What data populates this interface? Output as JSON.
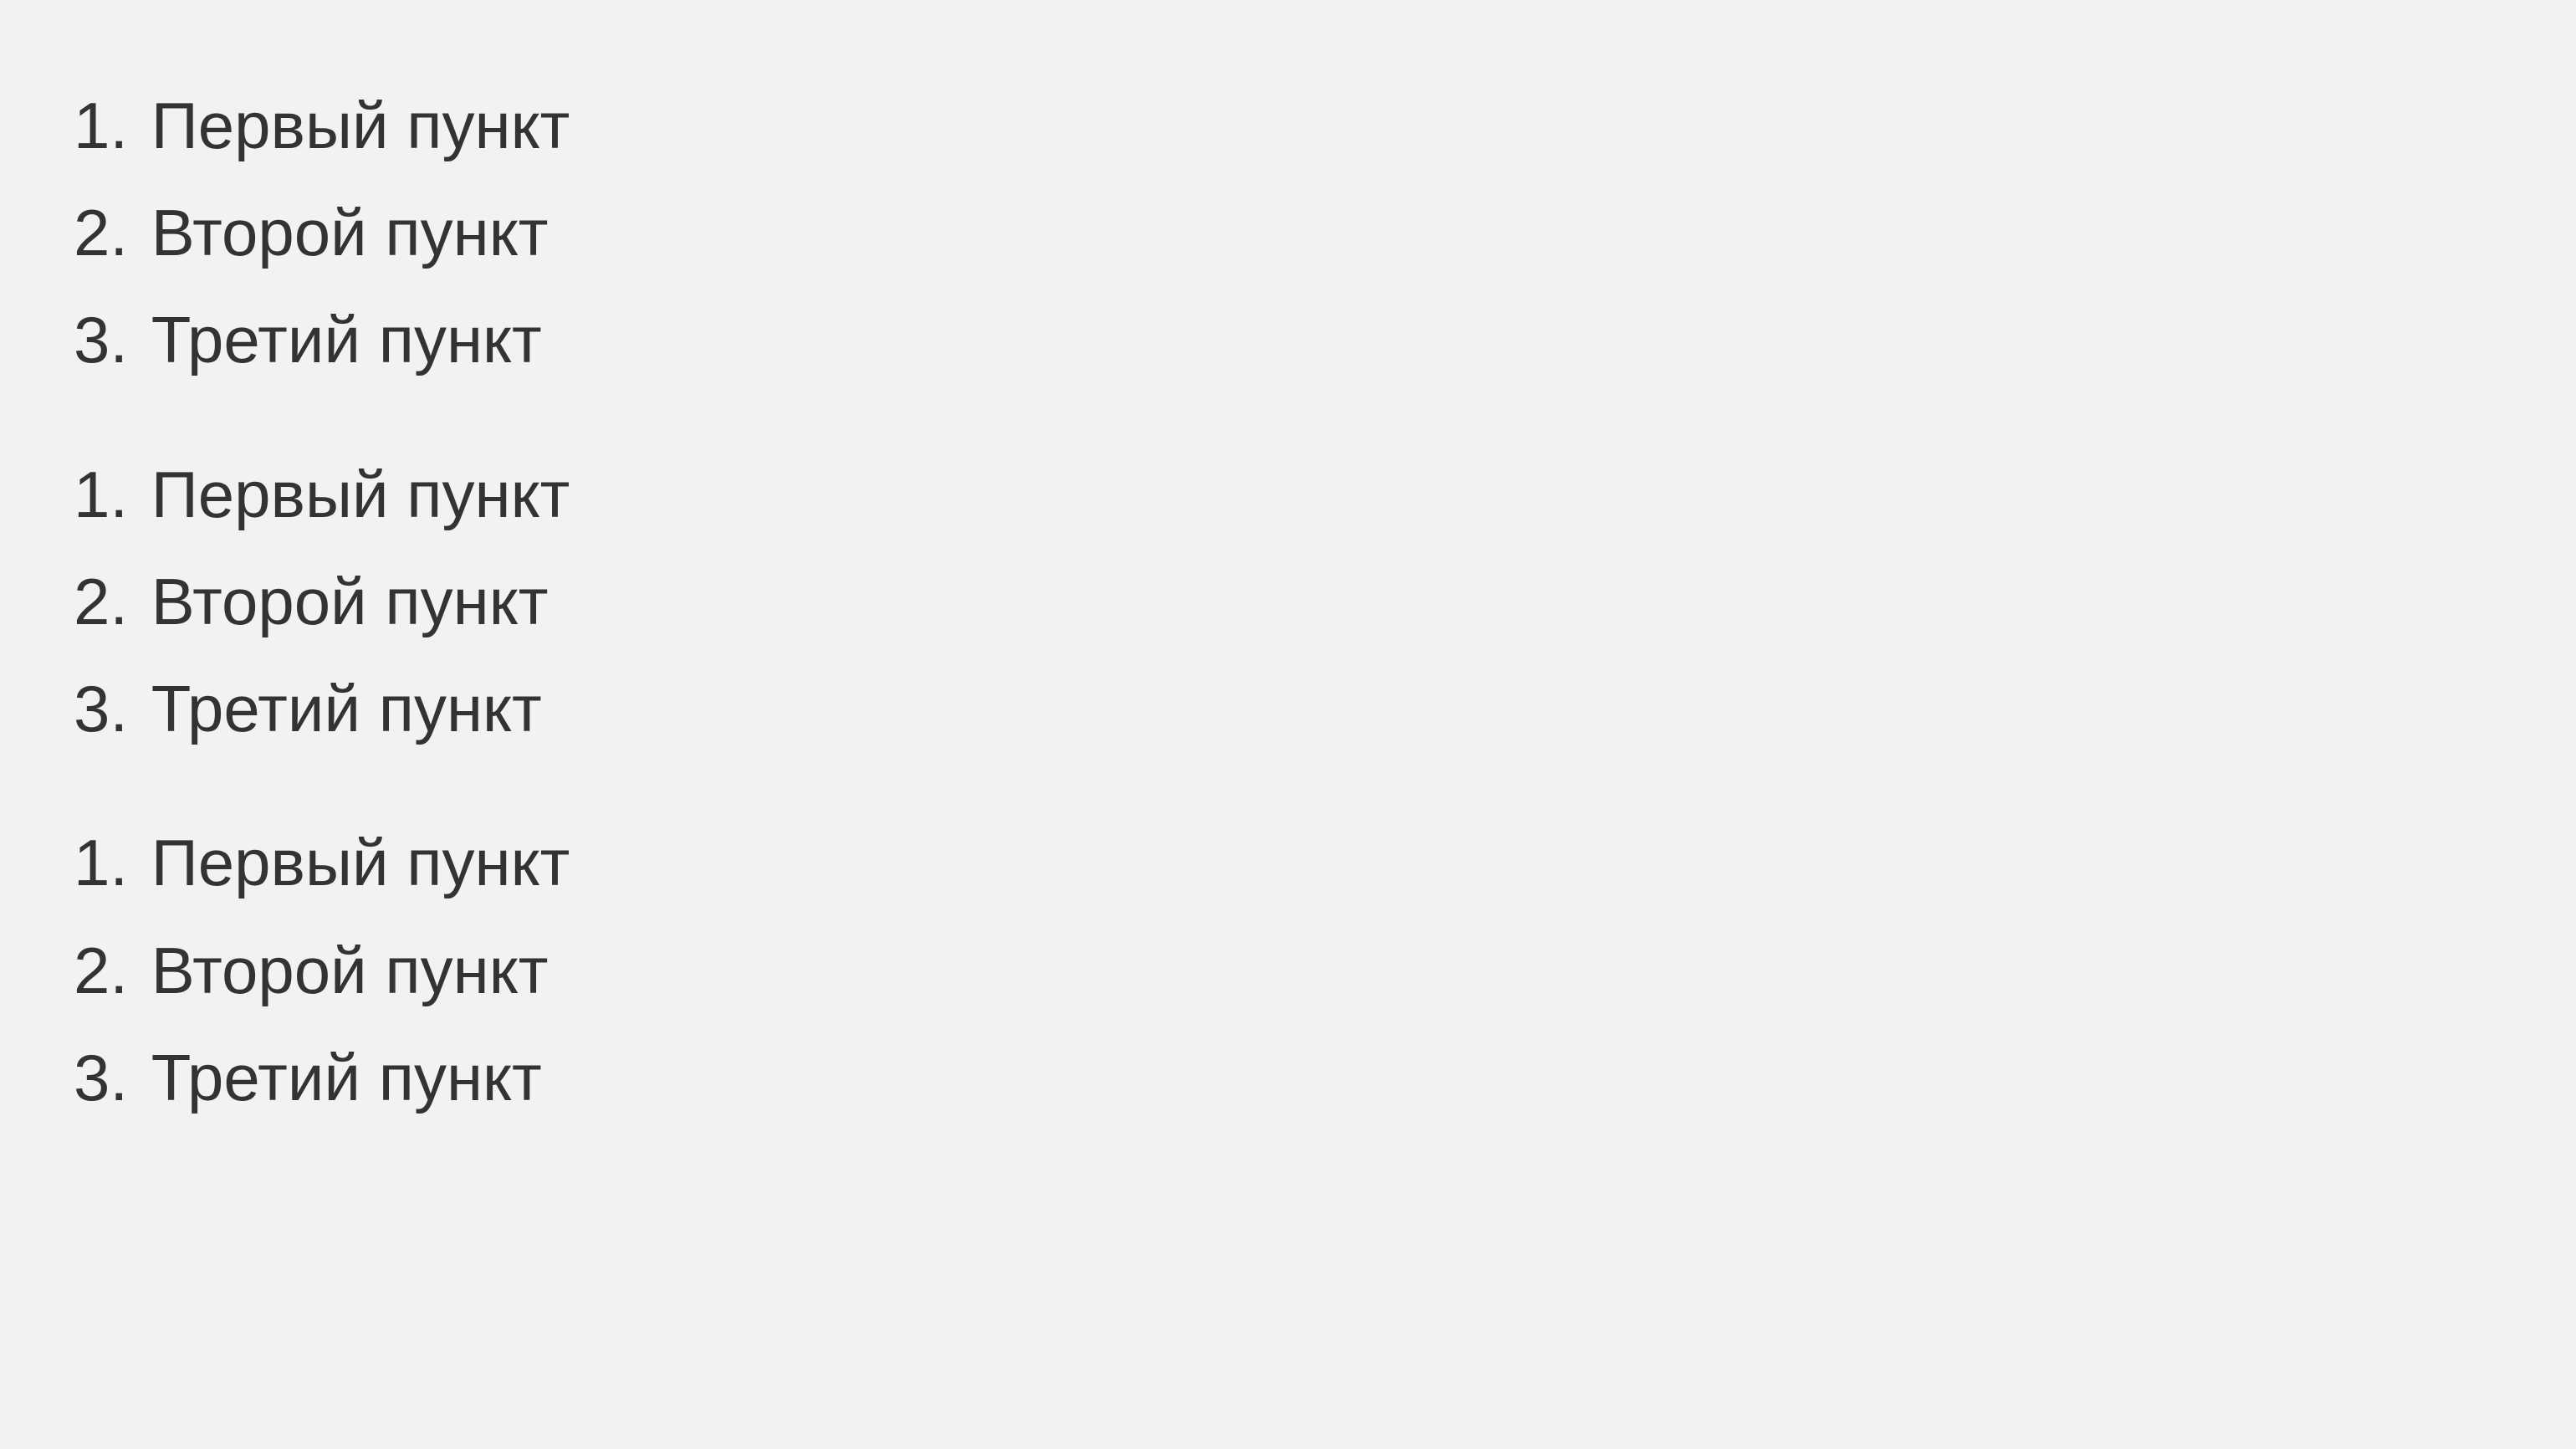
{
  "lists": [
    {
      "items": [
        {
          "number": "1.",
          "label": "Первый пункт"
        },
        {
          "number": "2.",
          "label": "Второй пункт"
        },
        {
          "number": "3.",
          "label": "Третий пункт"
        }
      ]
    },
    {
      "items": [
        {
          "number": "1.",
          "label": "Первый пункт"
        },
        {
          "number": "2.",
          "label": "Второй пункт"
        },
        {
          "number": "3.",
          "label": "Третий пункт"
        }
      ]
    },
    {
      "items": [
        {
          "number": "1.",
          "label": "Первый пункт"
        },
        {
          "number": "2.",
          "label": "Второй пункт"
        },
        {
          "number": "3.",
          "label": "Третий пункт"
        }
      ]
    }
  ]
}
